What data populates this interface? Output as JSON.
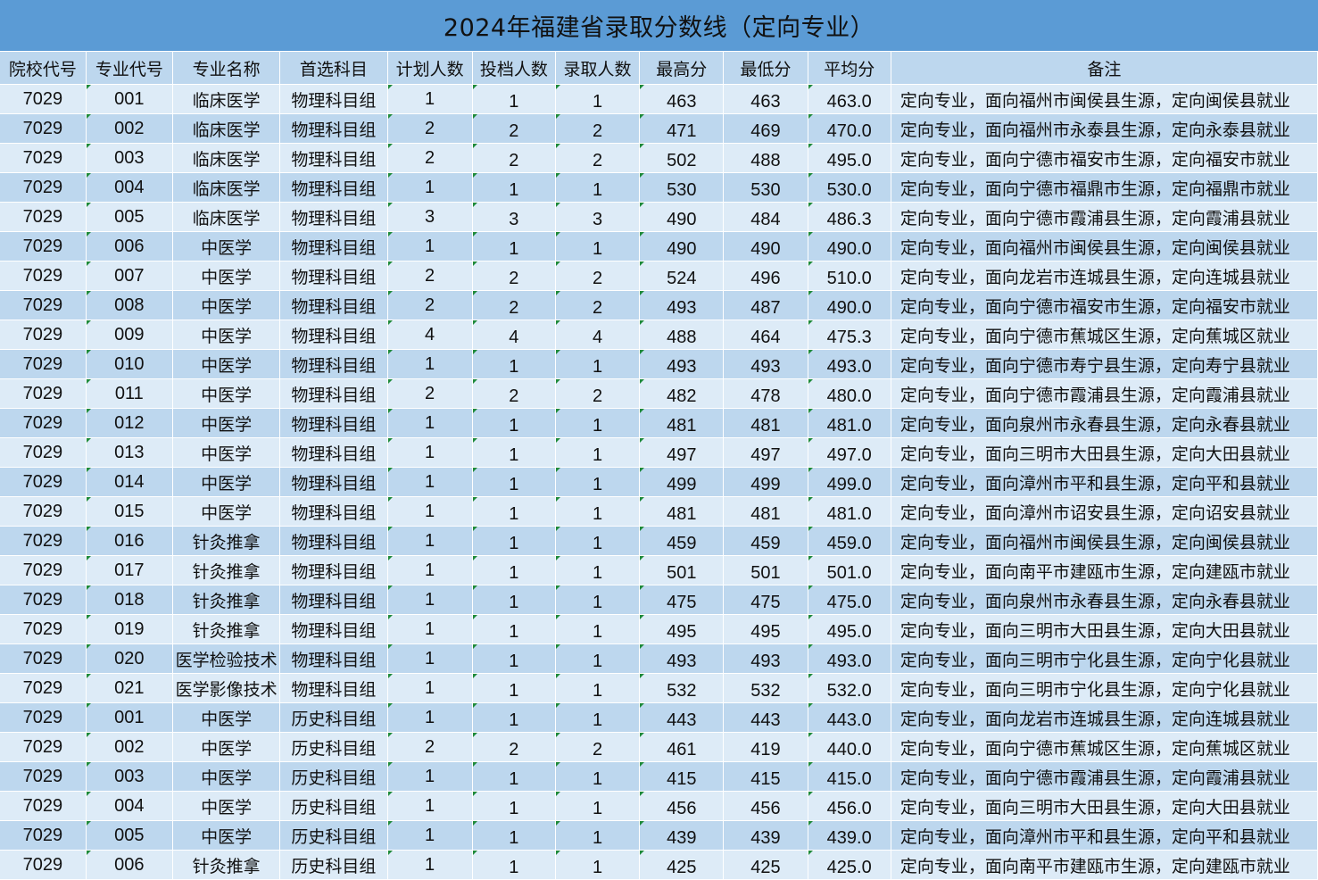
{
  "title": "2024年福建省录取分数线（定向专业）",
  "headers": [
    "院校代号",
    "专业代号",
    "专业名称",
    "首选科目",
    "计划人数",
    "投档人数",
    "录取人数",
    "最高分",
    "最低分",
    "平均分",
    "备注"
  ],
  "rows": [
    [
      "7029",
      "001",
      "临床医学",
      "物理科目组",
      "1",
      "1",
      "1",
      "463",
      "463",
      "463.0",
      "定向专业，面向福州市闽侯县生源，定向闽侯县就业"
    ],
    [
      "7029",
      "002",
      "临床医学",
      "物理科目组",
      "2",
      "2",
      "2",
      "471",
      "469",
      "470.0",
      "定向专业，面向福州市永泰县生源，定向永泰县就业"
    ],
    [
      "7029",
      "003",
      "临床医学",
      "物理科目组",
      "2",
      "2",
      "2",
      "502",
      "488",
      "495.0",
      "定向专业，面向宁德市福安市生源，定向福安市就业"
    ],
    [
      "7029",
      "004",
      "临床医学",
      "物理科目组",
      "1",
      "1",
      "1",
      "530",
      "530",
      "530.0",
      "定向专业，面向宁德市福鼎市生源，定向福鼎市就业"
    ],
    [
      "7029",
      "005",
      "临床医学",
      "物理科目组",
      "3",
      "3",
      "3",
      "490",
      "484",
      "486.3",
      "定向专业，面向宁德市霞浦县生源，定向霞浦县就业"
    ],
    [
      "7029",
      "006",
      "中医学",
      "物理科目组",
      "1",
      "1",
      "1",
      "490",
      "490",
      "490.0",
      "定向专业，面向福州市闽侯县生源，定向闽侯县就业"
    ],
    [
      "7029",
      "007",
      "中医学",
      "物理科目组",
      "2",
      "2",
      "2",
      "524",
      "496",
      "510.0",
      "定向专业，面向龙岩市连城县生源，定向连城县就业"
    ],
    [
      "7029",
      "008",
      "中医学",
      "物理科目组",
      "2",
      "2",
      "2",
      "493",
      "487",
      "490.0",
      "定向专业，面向宁德市福安市生源，定向福安市就业"
    ],
    [
      "7029",
      "009",
      "中医学",
      "物理科目组",
      "4",
      "4",
      "4",
      "488",
      "464",
      "475.3",
      "定向专业，面向宁德市蕉城区生源，定向蕉城区就业"
    ],
    [
      "7029",
      "010",
      "中医学",
      "物理科目组",
      "1",
      "1",
      "1",
      "493",
      "493",
      "493.0",
      "定向专业，面向宁德市寿宁县生源，定向寿宁县就业"
    ],
    [
      "7029",
      "011",
      "中医学",
      "物理科目组",
      "2",
      "2",
      "2",
      "482",
      "478",
      "480.0",
      "定向专业，面向宁德市霞浦县生源，定向霞浦县就业"
    ],
    [
      "7029",
      "012",
      "中医学",
      "物理科目组",
      "1",
      "1",
      "1",
      "481",
      "481",
      "481.0",
      "定向专业，面向泉州市永春县生源，定向永春县就业"
    ],
    [
      "7029",
      "013",
      "中医学",
      "物理科目组",
      "1",
      "1",
      "1",
      "497",
      "497",
      "497.0",
      "定向专业，面向三明市大田县生源，定向大田县就业"
    ],
    [
      "7029",
      "014",
      "中医学",
      "物理科目组",
      "1",
      "1",
      "1",
      "499",
      "499",
      "499.0",
      "定向专业，面向漳州市平和县生源，定向平和县就业"
    ],
    [
      "7029",
      "015",
      "中医学",
      "物理科目组",
      "1",
      "1",
      "1",
      "481",
      "481",
      "481.0",
      "定向专业，面向漳州市诏安县生源，定向诏安县就业"
    ],
    [
      "7029",
      "016",
      "针灸推拿",
      "物理科目组",
      "1",
      "1",
      "1",
      "459",
      "459",
      "459.0",
      "定向专业，面向福州市闽侯县生源，定向闽侯县就业"
    ],
    [
      "7029",
      "017",
      "针灸推拿",
      "物理科目组",
      "1",
      "1",
      "1",
      "501",
      "501",
      "501.0",
      "定向专业，面向南平市建瓯市生源，定向建瓯市就业"
    ],
    [
      "7029",
      "018",
      "针灸推拿",
      "物理科目组",
      "1",
      "1",
      "1",
      "475",
      "475",
      "475.0",
      "定向专业，面向泉州市永春县生源，定向永春县就业"
    ],
    [
      "7029",
      "019",
      "针灸推拿",
      "物理科目组",
      "1",
      "1",
      "1",
      "495",
      "495",
      "495.0",
      "定向专业，面向三明市大田县生源，定向大田县就业"
    ],
    [
      "7029",
      "020",
      "医学检验技术",
      "物理科目组",
      "1",
      "1",
      "1",
      "493",
      "493",
      "493.0",
      "定向专业，面向三明市宁化县生源，定向宁化县就业"
    ],
    [
      "7029",
      "021",
      "医学影像技术",
      "物理科目组",
      "1",
      "1",
      "1",
      "532",
      "532",
      "532.0",
      "定向专业，面向三明市宁化县生源，定向宁化县就业"
    ],
    [
      "7029",
      "001",
      "中医学",
      "历史科目组",
      "1",
      "1",
      "1",
      "443",
      "443",
      "443.0",
      "定向专业，面向龙岩市连城县生源，定向连城县就业"
    ],
    [
      "7029",
      "002",
      "中医学",
      "历史科目组",
      "2",
      "2",
      "2",
      "461",
      "419",
      "440.0",
      "定向专业，面向宁德市蕉城区生源，定向蕉城区就业"
    ],
    [
      "7029",
      "003",
      "中医学",
      "历史科目组",
      "1",
      "1",
      "1",
      "415",
      "415",
      "415.0",
      "定向专业，面向宁德市霞浦县生源，定向霞浦县就业"
    ],
    [
      "7029",
      "004",
      "中医学",
      "历史科目组",
      "1",
      "1",
      "1",
      "456",
      "456",
      "456.0",
      "定向专业，面向三明市大田县生源，定向大田县就业"
    ],
    [
      "7029",
      "005",
      "中医学",
      "历史科目组",
      "1",
      "1",
      "1",
      "439",
      "439",
      "439.0",
      "定向专业，面向漳州市平和县生源，定向平和县就业"
    ],
    [
      "7029",
      "006",
      "针灸推拿",
      "历史科目组",
      "1",
      "1",
      "1",
      "425",
      "425",
      "425.0",
      "定向专业，面向南平市建瓯市生源，定向建瓯市就业"
    ]
  ]
}
